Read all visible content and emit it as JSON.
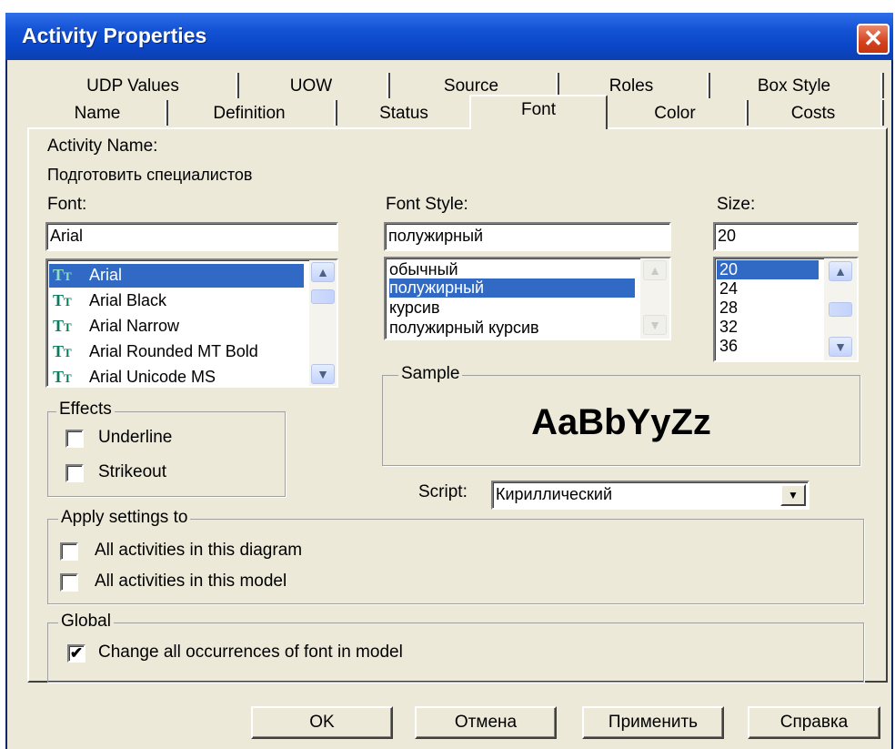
{
  "window": {
    "title": "Activity Properties"
  },
  "tabs_row1": [
    "UDP Values",
    "UOW",
    "Source",
    "Roles",
    "Box Style"
  ],
  "tabs_row2": [
    "Name",
    "Definition",
    "Status",
    "Font",
    "Color",
    "Costs"
  ],
  "active_tab": "Font",
  "activity": {
    "label": "Activity Name:",
    "value": "Подготовить специалистов"
  },
  "font": {
    "label": "Font:",
    "value": "Arial",
    "options": [
      "Arial",
      "Arial Black",
      "Arial Narrow",
      "Arial Rounded MT Bold",
      "Arial Unicode MS"
    ],
    "selected": "Arial"
  },
  "font_style": {
    "label": "Font Style:",
    "value": "полужирный",
    "options": [
      "обычный",
      "полужирный",
      "курсив",
      "полужирный курсив"
    ],
    "selected": "полужирный"
  },
  "size": {
    "label": "Size:",
    "value": "20",
    "options": [
      "20",
      "24",
      "28",
      "32",
      "36"
    ],
    "selected": "20"
  },
  "effects": {
    "title": "Effects",
    "underline": {
      "label": "Underline",
      "checked": false
    },
    "strikeout": {
      "label": "Strikeout",
      "checked": false
    }
  },
  "sample": {
    "title": "Sample",
    "text": "AaBbYyZz"
  },
  "script": {
    "label": "Script:",
    "value": "Кириллический"
  },
  "apply_settings": {
    "title": "Apply settings to",
    "diagram": {
      "label": "All activities in this diagram",
      "checked": false
    },
    "model": {
      "label": "All activities in this model",
      "checked": false
    }
  },
  "global": {
    "title": "Global",
    "change_all": {
      "label": "Change all occurrences of font in model",
      "checked": true
    }
  },
  "buttons": {
    "ok": "OK",
    "cancel": "Отмена",
    "apply": "Применить",
    "help": "Справка"
  },
  "icons": {
    "close": "close-icon",
    "truetype": "truetype-font-icon",
    "check": "checkmark-icon"
  },
  "colors": {
    "title_bar": "#0a47c8",
    "selection": "#316ac5",
    "window_bg": "#ece9d8",
    "close_button": "#d5421f"
  }
}
